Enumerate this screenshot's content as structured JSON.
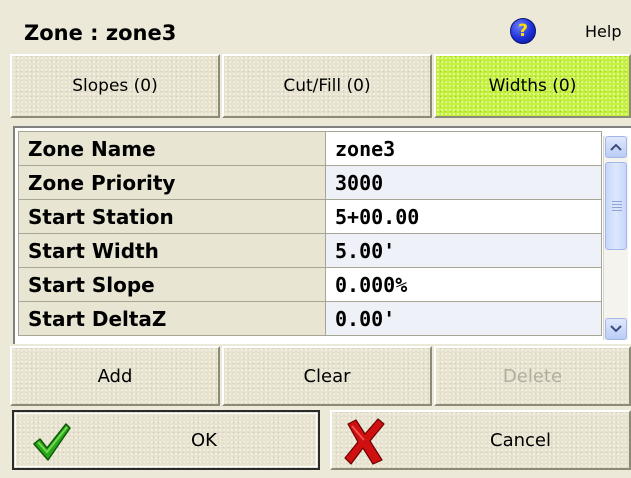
{
  "header": {
    "title": "Zone : zone3",
    "help_icon_glyph": "?",
    "help_label": "Help"
  },
  "tabs": [
    {
      "label": "Slopes (0)",
      "active": false
    },
    {
      "label": "Cut/Fill (0)",
      "active": false
    },
    {
      "label": "Widths (0)",
      "active": true
    }
  ],
  "properties": [
    {
      "name": "Zone Name",
      "value": "zone3"
    },
    {
      "name": "Zone Priority",
      "value": "3000"
    },
    {
      "name": "Start Station",
      "value": "5+00.00"
    },
    {
      "name": "Start Width",
      "value": "5.00'"
    },
    {
      "name": "Start Slope",
      "value": "0.000%"
    },
    {
      "name": "Start DeltaZ",
      "value": "0.00'"
    }
  ],
  "actions": {
    "add_label": "Add",
    "clear_label": "Clear",
    "delete_label": "Delete",
    "delete_enabled": false
  },
  "dialog": {
    "ok_label": "OK",
    "cancel_label": "Cancel",
    "ok_icon": "checkmark-icon",
    "cancel_icon": "red-x-icon"
  },
  "colors": {
    "active_tab": "#c4f23a",
    "help_icon": "#1c2fd6",
    "check": "#2aa61a",
    "cancel_x": "#d01010"
  }
}
